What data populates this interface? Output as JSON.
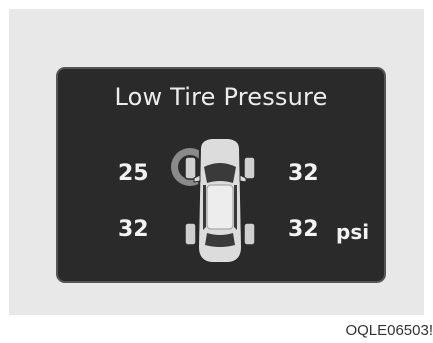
{
  "display": {
    "title": "Low Tire Pressure",
    "front_left": "25",
    "front_right": "32",
    "rear_left": "32",
    "rear_right": "32",
    "unit": "psi",
    "warning_tire": "front_left"
  },
  "caption": "OQLE06503!",
  "colors": {
    "screen": "#2a2a2a",
    "text": "#f2f2f2",
    "car": "#d9d9d9",
    "warning_halo": "#8a8a8a"
  },
  "icons": [
    "car-top-view-icon",
    "low-pressure-warning-icon"
  ]
}
